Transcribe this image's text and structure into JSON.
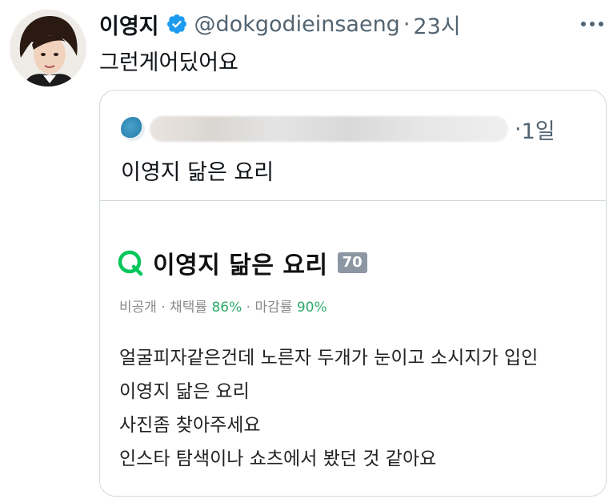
{
  "tweet": {
    "display_name": "이영지",
    "handle": "@dokgodieinsaeng",
    "separator": "·",
    "time": "23시",
    "text": "그런게어딨어요",
    "verified": true
  },
  "quote": {
    "separator": "·",
    "time": "1일",
    "text": "이영지 닮은 요리",
    "author_blurred": true
  },
  "embed": {
    "title": "이영지 닮은 요리",
    "points": "70",
    "meta": {
      "visibility": "비공개",
      "sep1": " · ",
      "adopt_label": "채택률",
      "adopt_rate": "86%",
      "sep2": " · ",
      "deadline_label": "마감률",
      "deadline_rate": "90%"
    },
    "lines": [
      "얼굴피자같은건데 노른자 두개가 눈이고 소시지가 입인",
      "이영지 닮은 요리",
      "사진좀 찾아주세요",
      "인스타 탐색이나 쇼츠에서 봤던 것 같아요"
    ]
  },
  "colors": {
    "text_primary": "#0f1419",
    "text_secondary": "#536471",
    "verified_blue": "#1d9bf0",
    "border": "#cfd9de",
    "naver_green": "#03c75a",
    "percent_green": "#2eaa6a",
    "badge_gray": "#8d96a3"
  },
  "icons": {
    "verified": "verified-badge-icon",
    "more": "more-options-icon",
    "search_q": "q-logo-icon"
  }
}
